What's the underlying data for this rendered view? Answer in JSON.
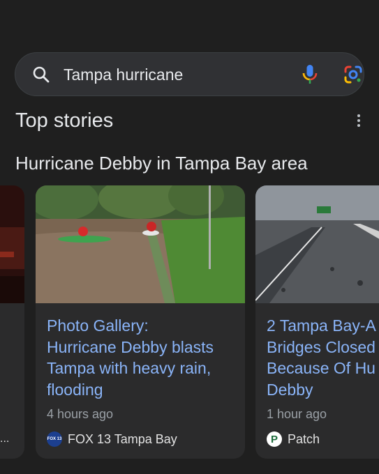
{
  "search": {
    "query": "Tampa hurricane"
  },
  "top_stories": {
    "title": "Top stories",
    "topic": "Hurricane Debby in Tampa Bay area",
    "cards": [
      {
        "headline_lines": [
          "Photo Gallery:",
          "Hurricane Debby blasts",
          "Tampa with heavy rain,",
          "flooding"
        ],
        "time": "4 hours ago",
        "source": "FOX 13 Tampa Bay",
        "source_logo_text": "FOX 13"
      },
      {
        "headline_lines": [
          "2 Tampa Bay-A",
          "Bridges Closed",
          "Because Of Hu",
          "Debby"
        ],
        "time": "1 hour ago",
        "source": "Patch",
        "source_logo_text": "P"
      }
    ],
    "partial_card_dots": "..."
  },
  "colors": {
    "background": "#1f1f1f",
    "link": "#8ab4f8",
    "muted": "#9aa0a6"
  }
}
